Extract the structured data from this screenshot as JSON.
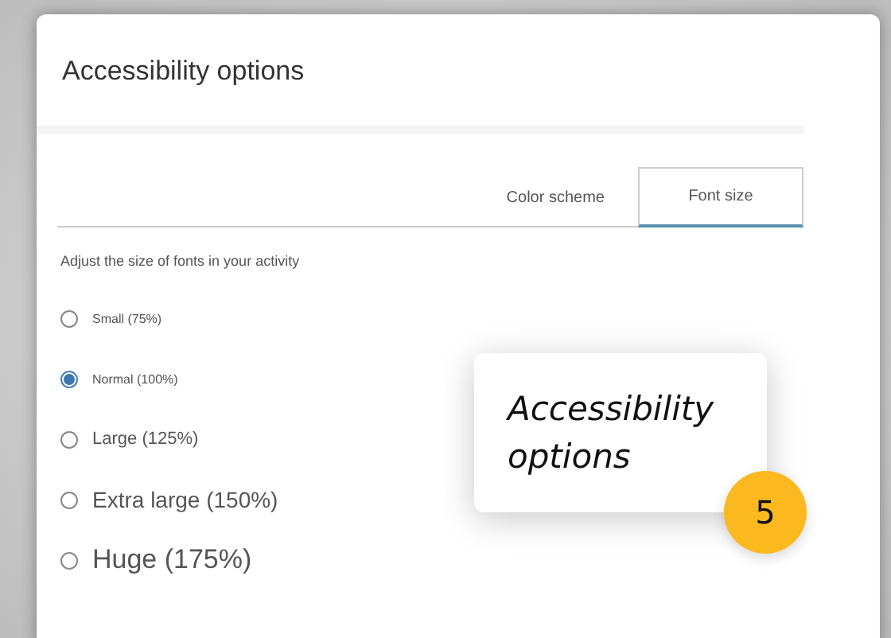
{
  "dialog": {
    "title": "Accessibility options"
  },
  "tabs": [
    {
      "label": "Color scheme",
      "selected": false
    },
    {
      "label": "Font size",
      "selected": true
    }
  ],
  "description": "Adjust the size of fonts in your activity",
  "options": [
    {
      "label": "Small (75%)",
      "selected": false
    },
    {
      "label": "Normal (100%)",
      "selected": true
    },
    {
      "label": "Large (125%)",
      "selected": false
    },
    {
      "label": "Extra large (150%)",
      "selected": false
    },
    {
      "label": "Huge (175%)",
      "selected": false
    }
  ],
  "callout": {
    "text": "Accessibility options",
    "step": "5"
  }
}
